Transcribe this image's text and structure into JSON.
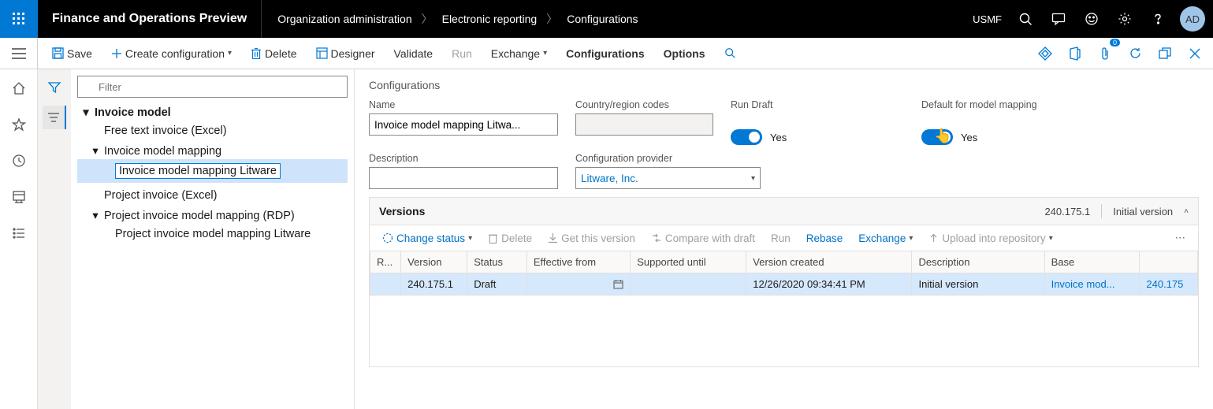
{
  "header": {
    "app_title": "Finance and Operations Preview",
    "breadcrumb": [
      "Organization administration",
      "Electronic reporting",
      "Configurations"
    ],
    "company": "USMF",
    "avatar_initials": "AD"
  },
  "cmdbar": {
    "save": "Save",
    "create": "Create configuration",
    "delete": "Delete",
    "designer": "Designer",
    "validate": "Validate",
    "run": "Run",
    "exchange": "Exchange",
    "configurations": "Configurations",
    "options": "Options"
  },
  "tree": {
    "filter_placeholder": "Filter",
    "nodes": {
      "root": "Invoice model",
      "free_text": "Free text invoice (Excel)",
      "imm": "Invoice model mapping",
      "imm_litware": "Invoice model mapping Litware",
      "project_excel": "Project invoice (Excel)",
      "project_rdp": "Project invoice model mapping (RDP)",
      "project_rdp_litware": "Project invoice model mapping Litware"
    }
  },
  "form": {
    "section_title": "Configurations",
    "labels": {
      "name": "Name",
      "country": "Country/region codes",
      "run_draft": "Run Draft",
      "default_mapping": "Default for model mapping",
      "description": "Description",
      "provider": "Configuration provider"
    },
    "values": {
      "name": "Invoice model mapping Litwa...",
      "country": "",
      "description": "",
      "provider": "Litware, Inc.",
      "run_draft_text": "Yes",
      "default_mapping_text": "Yes"
    }
  },
  "versions": {
    "header_title": "Versions",
    "header_version": "240.175.1",
    "header_desc": "Initial version",
    "cmds": {
      "change_status": "Change status",
      "delete": "Delete",
      "get_this": "Get this version",
      "compare": "Compare with draft",
      "run": "Run",
      "rebase": "Rebase",
      "exchange": "Exchange",
      "upload": "Upload into repository"
    },
    "columns": {
      "r": "R...",
      "version": "Version",
      "status": "Status",
      "effective": "Effective from",
      "supported": "Supported until",
      "created": "Version created",
      "description": "Description",
      "base": "Base",
      "base2": ""
    },
    "rows": [
      {
        "version": "240.175.1",
        "status": "Draft",
        "effective": "",
        "supported": "",
        "created": "12/26/2020 09:34:41 PM",
        "description": "Initial version",
        "base_name": "Invoice mod...",
        "base_ver": "240.175"
      }
    ]
  }
}
